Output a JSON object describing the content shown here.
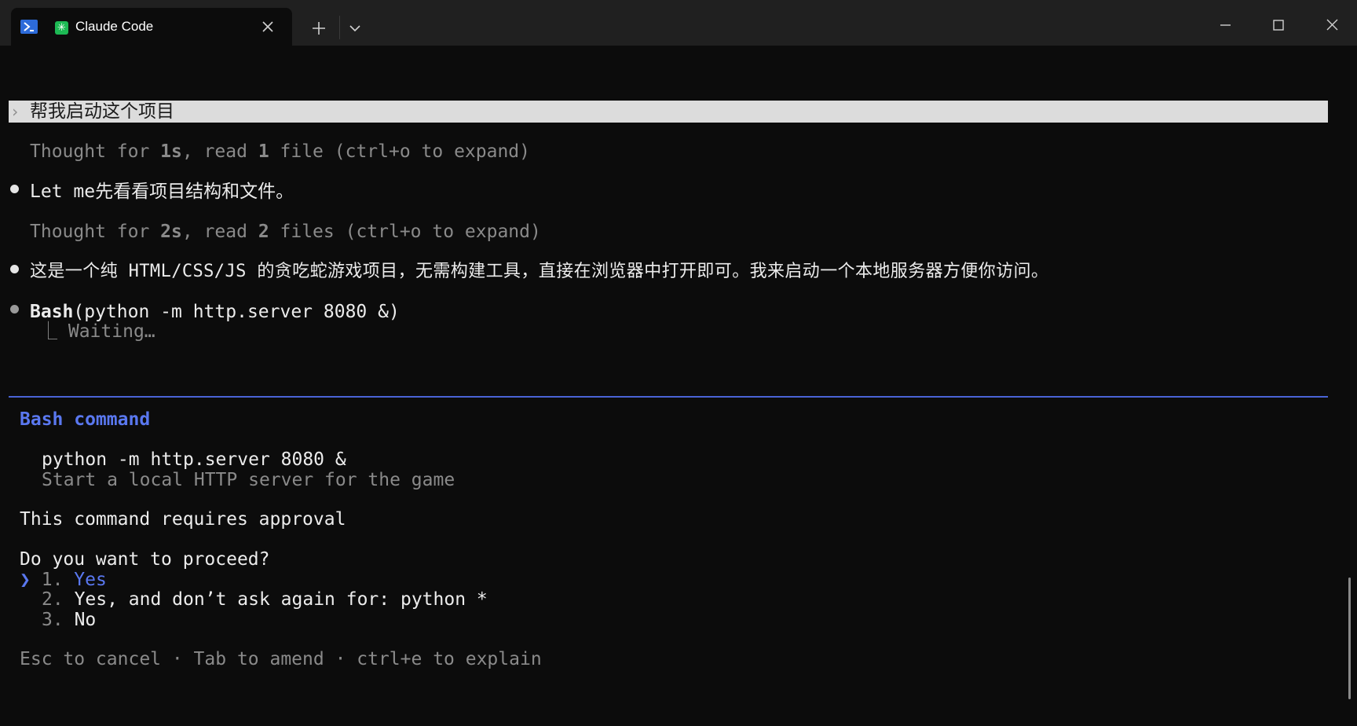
{
  "window": {
    "tab_title": "Claude Code",
    "icons": {
      "shell": "powershell-icon",
      "app": "claude-code-icon",
      "close": "close-icon",
      "new_tab": "plus-icon",
      "dropdown": "chevron-down-icon"
    },
    "app_icon_glyph": "✳"
  },
  "conversation": {
    "user_prompt": "帮我启动这个项目",
    "user_chevron": "›",
    "thought1": {
      "prefix": "Thought for ",
      "duration": "1s",
      "rest": ", read ",
      "count": "1",
      "suffix": " file (ctrl+o to expand)"
    },
    "assistant1": "Let me先看看项目结构和文件。",
    "thought2": {
      "prefix": "Thought for ",
      "duration": "2s",
      "rest": ", read ",
      "count": "2",
      "suffix": " files (ctrl+o to expand)"
    },
    "assistant2": "这是一个纯 HTML/CSS/JS 的贪吃蛇游戏项目，无需构建工具，直接在浏览器中打开即可。我来启动一个本地服务器方便你访问。",
    "tool_name": "Bash",
    "tool_args": "(python -m http.server 8080 &)",
    "tool_status_prefix": "⎿",
    "tool_status": "Waiting…"
  },
  "approval": {
    "title": "Bash command",
    "command": "python -m http.server 8080 &",
    "description": "Start a local HTTP server for the game",
    "notice": "This command requires approval",
    "question": "Do you want to proceed?",
    "selector": "❯",
    "options": [
      {
        "num": "1.",
        "label": "Yes"
      },
      {
        "num": "2.",
        "label": "Yes, and don’t ask again for: python *"
      },
      {
        "num": "3.",
        "label": "No"
      }
    ],
    "footer": "Esc to cancel · Tab to amend · ctrl+e to explain"
  },
  "colors": {
    "accent": "#5a78f0",
    "background": "#0c0c0c",
    "titlebar": "#202020",
    "highlight": "#dcdcdc"
  }
}
